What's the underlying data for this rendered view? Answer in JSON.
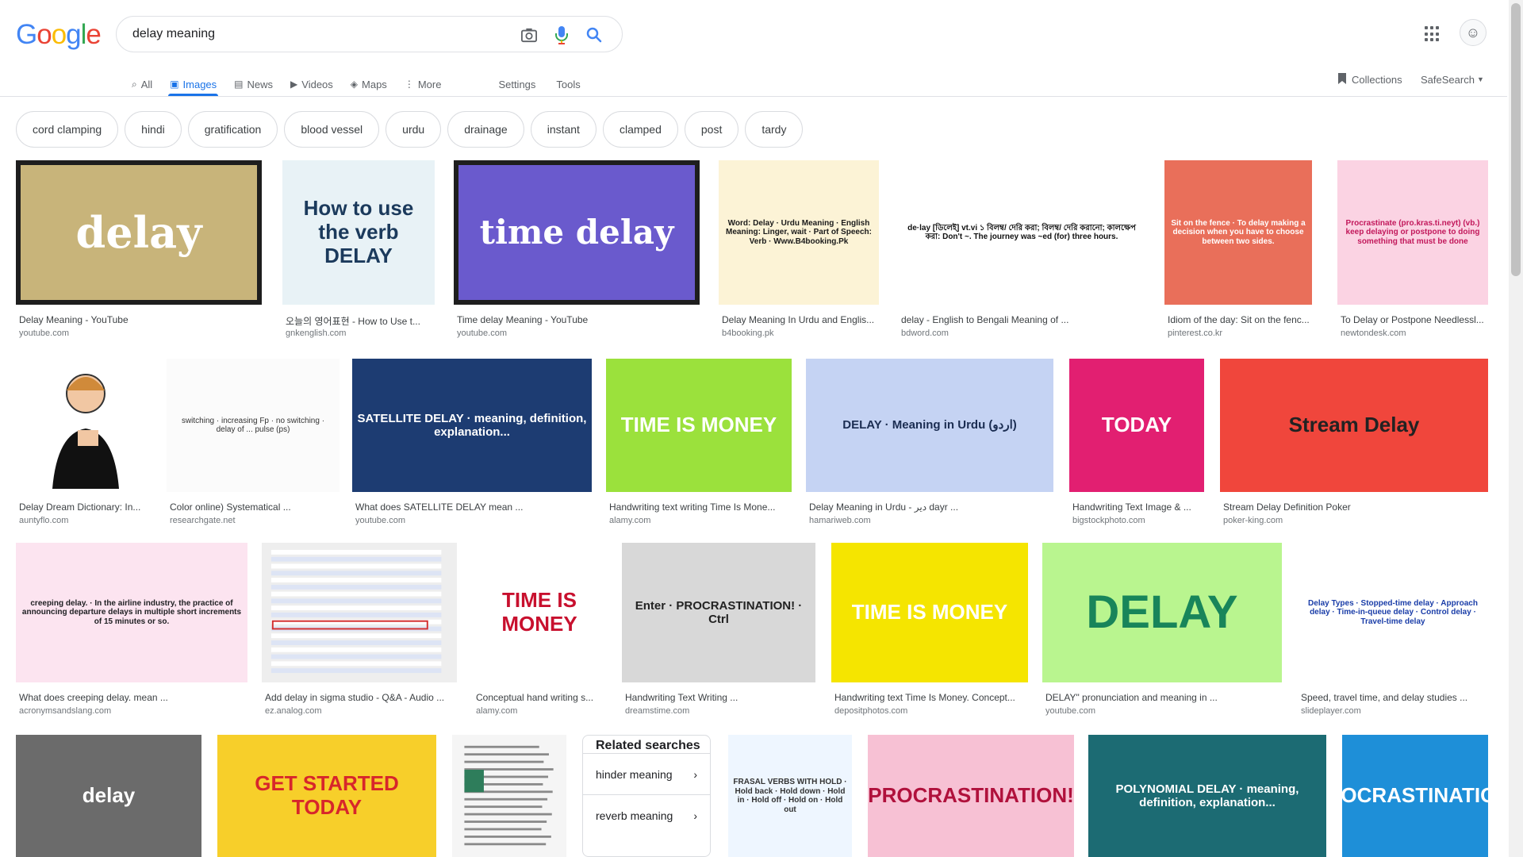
{
  "logo": {
    "text": "Google",
    "letters": [
      "G",
      "o",
      "o",
      "g",
      "l",
      "e"
    ],
    "colors": [
      "#4285f4",
      "#ea4335",
      "#fbbc05",
      "#4285f4",
      "#34a853",
      "#ea4335"
    ]
  },
  "search": {
    "query": "delay meaning",
    "icons": [
      "camera-icon",
      "microphone-icon",
      "search-icon"
    ]
  },
  "tabs": [
    {
      "label": "All",
      "icon": "search-icon",
      "glyph": "⌕"
    },
    {
      "label": "Images",
      "icon": "image-icon",
      "glyph": "▣",
      "active": true
    },
    {
      "label": "News",
      "icon": "news-icon",
      "glyph": "▤"
    },
    {
      "label": "Videos",
      "icon": "play-icon",
      "glyph": "▶"
    },
    {
      "label": "Maps",
      "icon": "map-icon",
      "glyph": "◈"
    },
    {
      "label": "More",
      "icon": "more-vert-icon",
      "glyph": "⋮"
    }
  ],
  "tools": {
    "settings": "Settings",
    "tools": "Tools",
    "collections": "Collections",
    "safesearch": "SafeSearch"
  },
  "chips": [
    "cord clamping",
    "hindi",
    "gratification",
    "blood vessel",
    "urdu",
    "drainage",
    "instant",
    "clamped",
    "post",
    "tardy"
  ],
  "results": [
    {
      "title": "Delay Meaning - YouTube",
      "source": "youtube.com",
      "bg": "#c8b47a",
      "text": "delay",
      "fg": "#ffffff"
    },
    {
      "title": "오늘의 영어표현 - How to Use t...",
      "source": "gnkenglish.com",
      "bg": "#e8f2f6",
      "text": "How to use the verb DELAY",
      "fg": "#1b3a5c"
    },
    {
      "title": "Time delay Meaning - YouTube",
      "source": "youtube.com",
      "bg": "#6a5acd",
      "text": "time delay",
      "fg": "#ffffff"
    },
    {
      "title": "Delay Meaning In Urdu and Englis...",
      "source": "b4booking.pk",
      "bg": "#fcf3d6",
      "text": "Word: Delay · Urdu Meaning · English Meaning: Linger, wait · Part of Speech: Verb · Www.B4booking.Pk",
      "fg": "#1a1a1a"
    },
    {
      "title": "delay - English to Bengali Meaning of ...",
      "source": "bdword.com",
      "bg": "#ffffff",
      "text": "de·lay [ডিলেই] vt.vi ১ বিলম্ব/ দেরি করা; বিলম্ব/ দেরি করানো; কালক্ষেপ করা: Don't ~. The journey was ~ed (for) three hours.",
      "fg": "#111111"
    },
    {
      "title": "Idiom of the day: Sit on the fenc...",
      "source": "pinterest.co.kr",
      "bg": "#e96f5a",
      "text": "Sit on the fence · To delay making a decision when you have to choose between two sides.",
      "fg": "#ffffff"
    },
    {
      "title": "To Delay or Postpone Needlessl...",
      "source": "newtondesk.com",
      "bg": "#fbd3e3",
      "text": "Procrastinate (pro.kras.ti.neyt) (vb.) keep delaying or postpone to doing something that must be done",
      "fg": "#c2185b"
    },
    {
      "title": "Delay Dream Dictionary: In...",
      "source": "auntyflo.com",
      "bg": "#ffffff",
      "text": "",
      "fg": "#000000"
    },
    {
      "title": "Color online) Systematical ...",
      "source": "researchgate.net",
      "bg": "#fbfbfb",
      "text": "switching · increasing Fp · no switching · delay of ... pulse (ps)",
      "fg": "#333333"
    },
    {
      "title": "What does SATELLITE DELAY mean ...",
      "source": "youtube.com",
      "bg": "#1d3c72",
      "text": "SATELLITE DELAY · meaning, definition, explanation...",
      "fg": "#ffffff"
    },
    {
      "title": "Handwriting text writing Time Is Mone...",
      "source": "alamy.com",
      "bg": "#9be13c",
      "text": "TIME IS MONEY",
      "fg": "#ffffff"
    },
    {
      "title": "Delay Meaning in Urdu - دیر dayr ...",
      "source": "hamariweb.com",
      "bg": "#c5d3f3",
      "text": "DELAY · Meaning in Urdu (اردو)",
      "fg": "#1b2d52"
    },
    {
      "title": "Handwriting Text Image & ...",
      "source": "bigstockphoto.com",
      "bg": "#e21f71",
      "text": "TODAY",
      "fg": "#ffffff"
    },
    {
      "title": "Stream Delay Definition Poker",
      "source": "poker-king.com",
      "bg": "#f0463c",
      "text": "Stream Delay",
      "fg": "#222222"
    },
    {
      "title": "What does creeping delay. mean ...",
      "source": "acronymsandslang.com",
      "bg": "#fce4f0",
      "text": "creeping delay. · In the airline industry, the practice of announcing departure delays in multiple short increments of 15 minutes or so.",
      "fg": "#202124"
    },
    {
      "title": "Add delay in sigma studio - Q&A - Audio ...",
      "source": "ez.analog.com",
      "bg": "#eeeeee",
      "text": "",
      "fg": "#2244aa"
    },
    {
      "title": "Conceptual hand writing s...",
      "source": "alamy.com",
      "bg": "#ffffff",
      "text": "TIME IS MONEY",
      "fg": "#c8102e"
    },
    {
      "title": "Handwriting Text Writing ...",
      "source": "dreamstime.com",
      "bg": "#d8d8d8",
      "text": "Enter · PROCRASTINATION! · Ctrl",
      "fg": "#222222"
    },
    {
      "title": "Handwriting text Time Is Money. Concept...",
      "source": "depositphotos.com",
      "bg": "#f5e500",
      "text": "TIME IS MONEY",
      "fg": "#ffffff"
    },
    {
      "title": "DELAY\" pronunciation and meaning in ...",
      "source": "youtube.com",
      "bg": "#b9f58f",
      "text": "DELAY",
      "fg": "#18855a"
    },
    {
      "title": "Speed, travel time, and delay studies ...",
      "source": "slideplayer.com",
      "bg": "#ffffff",
      "text": "Delay Types · Stopped-time delay · Approach delay · Time-in-queue delay · Control delay · Travel-time delay",
      "fg": "#1a3da8"
    },
    {
      "title": "",
      "source": "",
      "bg": "#6b6b6b",
      "text": "delay",
      "fg": "#ffffff"
    },
    {
      "title": "",
      "source": "",
      "bg": "#f7cf2a",
      "text": "GET STARTED TODAY",
      "fg": "#d7262b"
    },
    {
      "title": "",
      "source": "",
      "bg": "#f5f5f5",
      "text": "",
      "fg": "#333333"
    },
    {
      "title": "",
      "source": "",
      "bg": "#eef6ff",
      "text": "FRASAL VERBS WITH HOLD · Hold back · Hold down · Hold in · Hold off · Hold on · Hold out",
      "fg": "#333333"
    },
    {
      "title": "",
      "source": "",
      "bg": "#f7c1d4",
      "text": "PROCRASTINATION!",
      "fg": "#b0113c"
    },
    {
      "title": "",
      "source": "",
      "bg": "#1c6b73",
      "text": "POLYNOMIAL DELAY · meaning, definition, explanation...",
      "fg": "#ffffff"
    },
    {
      "title": "",
      "source": "",
      "bg": "#1e8fd8",
      "text": "PROCRASTINATION!",
      "fg": "#ffffff"
    }
  ],
  "related": {
    "heading": "Related searches",
    "items": [
      "hinder meaning",
      "reverb meaning"
    ]
  }
}
